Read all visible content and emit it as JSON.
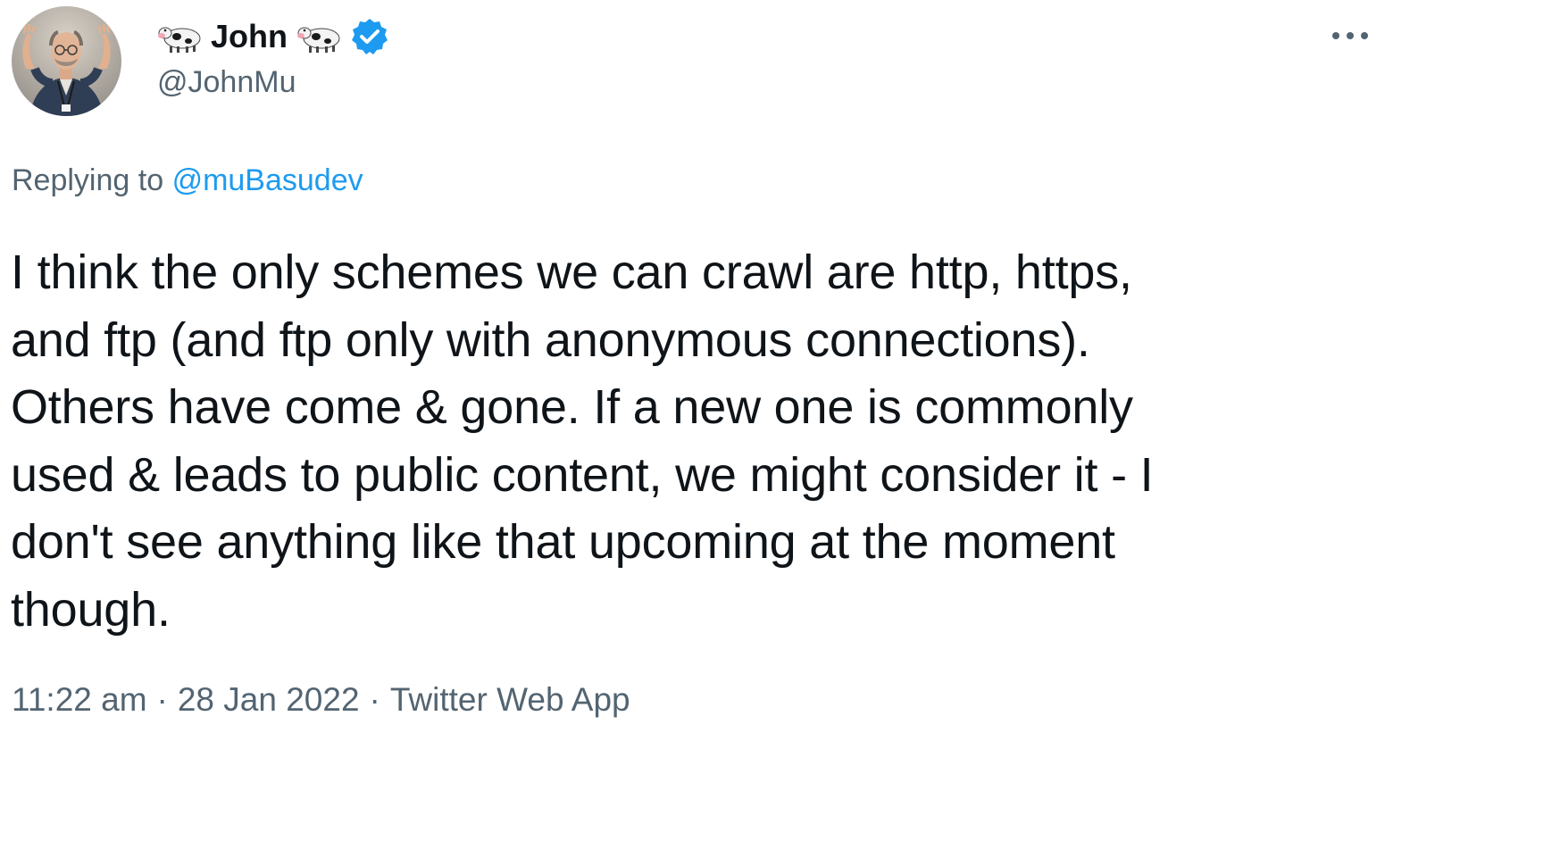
{
  "author": {
    "display_name": "John",
    "name_emoji": "cow-face-emoji",
    "handle": "@JohnMu",
    "verified": true,
    "avatar_icon": "profile-photo-avatar"
  },
  "header": {
    "more_icon": "ellipsis-icon"
  },
  "reply": {
    "prefix": "Replying to",
    "mention": "@muBasudev"
  },
  "tweet": {
    "lines": [
      "I think the only schemes we can crawl are http, https,",
      "and ftp (and ftp only with anonymous connections).",
      "Others have come & gone. If a new one is commonly",
      "used & leads to public content, we might consider it - I",
      "don't see anything like that upcoming at the moment",
      "though."
    ]
  },
  "meta": {
    "time": "11:22 am",
    "separator": "·",
    "date": "28 Jan 2022",
    "source": "Twitter Web App"
  },
  "colors": {
    "text_primary": "#0f1419",
    "text_secondary": "#536471",
    "accent": "#1d9bf0"
  }
}
